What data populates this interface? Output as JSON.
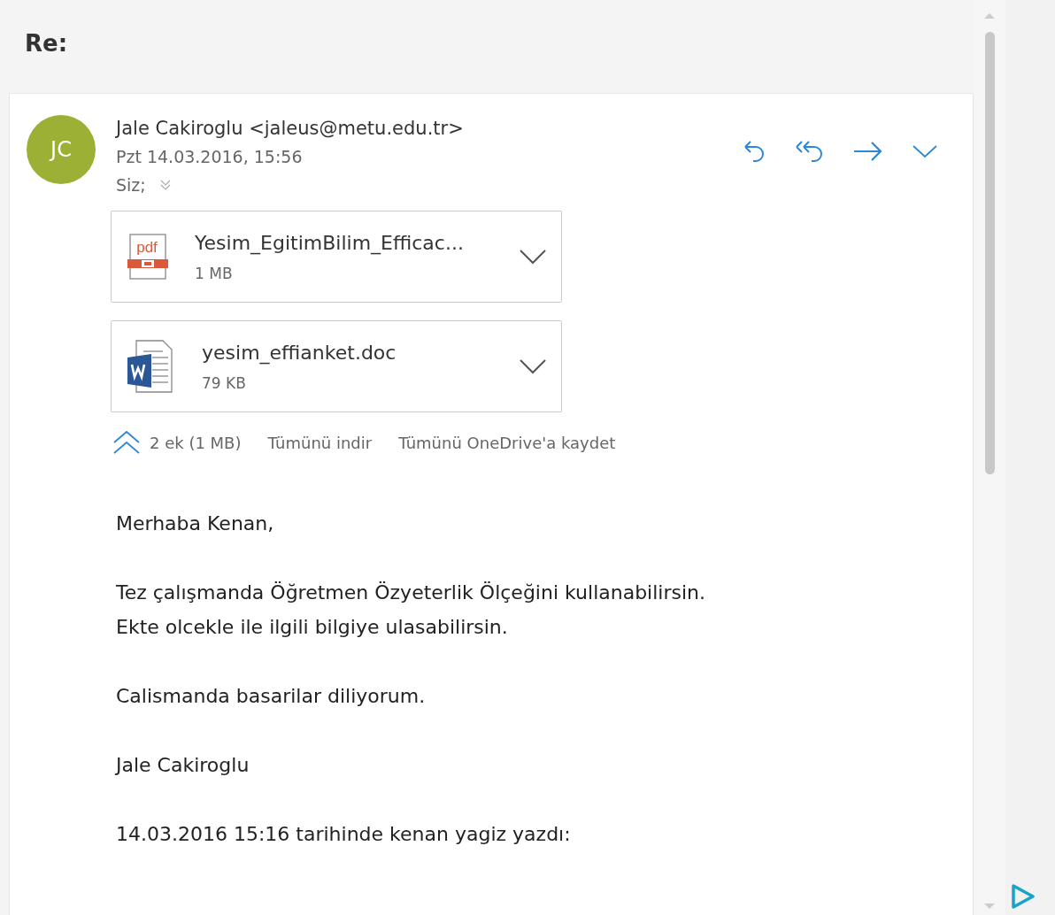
{
  "subject": "Re:",
  "sender": {
    "initials": "JC",
    "name": "Jale Cakiroglu <jaleus@metu.edu.tr>",
    "date": "Pzt 14.03.2016, 15:56",
    "to": "Siz;"
  },
  "attachments": [
    {
      "kind": "pdf",
      "name": "Yesim_EgitimBilim_Efficac...",
      "size": "1 MB"
    },
    {
      "kind": "word",
      "name": "yesim_effianket.doc",
      "size": "79 KB"
    }
  ],
  "attachment_bar": {
    "summary": "2 ek (1 MB)",
    "links": [
      "Tümünü indir",
      "Tümünü OneDrive'a kaydet"
    ]
  },
  "body": [
    "Merhaba Kenan,",
    "Tez çalışmanda Öğretmen Özyeterlik Ölçeğini kullanabilirsin. Ekte olcekle ile ilgili bilgiye ulasabilirsin.",
    "Calismanda basarilar diliyorum.",
    "Jale Cakiroglu",
    "14.03.2016 15:16 tarihinde kenan yagiz yazdı:"
  ]
}
